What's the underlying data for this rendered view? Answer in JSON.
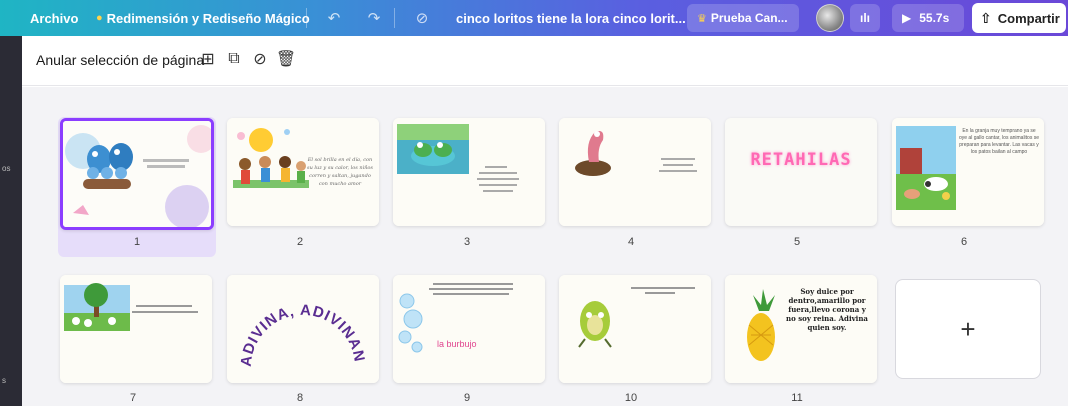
{
  "topbar": {
    "archivo": "Archivo",
    "resize": "Redimensión y Rediseño Mágico",
    "title": "cinco loritos tiene la lora cinco lorit...",
    "trial": "Prueba Can...",
    "time": "55.7s",
    "share": "Compartir"
  },
  "leftstrip": {
    "label": "os",
    "label2": "s"
  },
  "toolbar": {
    "deselect": "Anular selección de página"
  },
  "pages": {
    "p1": "1",
    "p2": "2",
    "p3": "3",
    "p4": "4",
    "p5": "5",
    "p6": "6",
    "p7": "7",
    "p8": "8",
    "p9": "9",
    "p10": "10",
    "p11": "11"
  },
  "slides": {
    "s5_title": "RETAHILAS",
    "s8_title": "ADIVINA, ADIVINANZA",
    "s9_title": "la burbujo",
    "s11_text": "Soy dulce por dentro,amarillo por fuera,llevo corona y no soy reina. Adivina quien soy.",
    "s2_text": "El sol brilla en el día, con su luz y su calor, los niños corren y saltan, jugando con mucho amor",
    "s6_text": "En la granja muy temprano ya se oye al gallo cantar, los animalitos se preparan para levantar. Las vacas y los patos bailan al campo"
  },
  "add_label": "+",
  "colors": {
    "accent": "#8b3dff"
  }
}
